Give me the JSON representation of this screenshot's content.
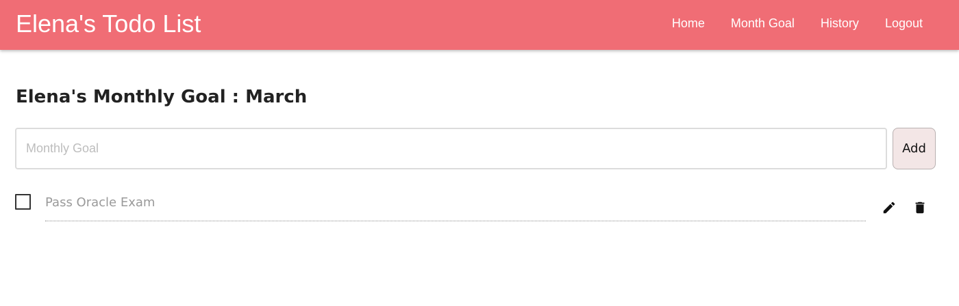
{
  "navbar": {
    "brand": "Elena's Todo List",
    "links": [
      {
        "label": "Home"
      },
      {
        "label": "Month Goal"
      },
      {
        "label": "History"
      },
      {
        "label": "Logout"
      }
    ],
    "background_color": "#f06d75"
  },
  "main": {
    "title": "Elena's Monthly Goal : March",
    "goal_input": {
      "value": "",
      "placeholder": "Monthly Goal"
    },
    "add_button_label": "Add",
    "todos": [
      {
        "text": "Pass Oracle Exam",
        "checked": false,
        "actions": [
          "pencil-icon",
          "trash-icon"
        ]
      }
    ]
  }
}
